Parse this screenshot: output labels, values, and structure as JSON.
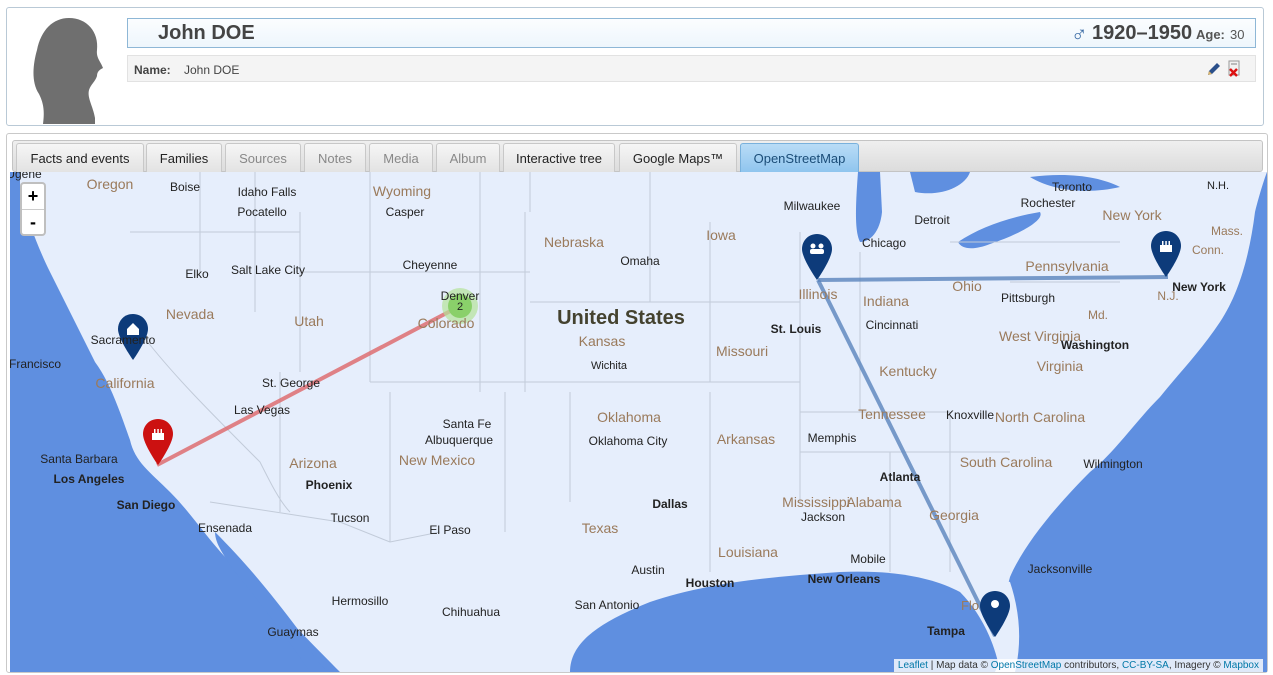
{
  "person": {
    "name": "John DOE",
    "gender_symbol": "♂",
    "lifespan": "1920–1950",
    "age_label": "Age:",
    "age_value": "30",
    "fact_name_label": "Name:",
    "fact_name_value": "John DOE"
  },
  "tabs": [
    {
      "label": "Facts and events",
      "state": "normal"
    },
    {
      "label": "Families",
      "state": "normal"
    },
    {
      "label": "Sources",
      "state": "dim"
    },
    {
      "label": "Notes",
      "state": "dim"
    },
    {
      "label": "Media",
      "state": "dim"
    },
    {
      "label": "Album",
      "state": "dim"
    },
    {
      "label": "Interactive tree",
      "state": "normal"
    },
    {
      "label": "Google Maps™",
      "state": "normal"
    },
    {
      "label": "OpenStreetMap",
      "state": "active"
    }
  ],
  "map": {
    "zoom_in": "+",
    "zoom_out": "-",
    "country_label": "United States",
    "states": [
      "Oregon",
      "Wyoming",
      "Nebraska",
      "Iowa",
      "Nevada",
      "Utah",
      "Colorado",
      "Kansas",
      "Missouri",
      "Illinois",
      "Indiana",
      "Ohio",
      "Pennsylvania",
      "New York",
      "California",
      "Kentucky",
      "West Virginia",
      "Virginia",
      "Tennessee",
      "North Carolina",
      "Oklahoma",
      "Arkansas",
      "Arizona",
      "New Mexico",
      "South Carolina",
      "Mississippi",
      "Alabama",
      "Georgia",
      "Texas",
      "Louisiana",
      "N.J.",
      "Mass.",
      "Conn.",
      "Md.",
      "Flo"
    ],
    "cities": [
      "Boise",
      "Idaho Falls",
      "Pocatello",
      "Casper",
      "Cheyenne",
      "Omaha",
      "Milwaukee",
      "Chicago",
      "Detroit",
      "Toronto",
      "Rochester",
      "Elko",
      "Salt Lake City",
      "Denver",
      "Sacramento",
      "Francisco",
      "St. George",
      "Las Vegas",
      "Santa Barbara",
      "Los Angeles",
      "San Diego",
      "Ensenada",
      "Phoenix",
      "Tucson",
      "Santa Fe",
      "Albuquerque",
      "El Paso",
      "Hermosillo",
      "Chihuahua",
      "Guaymas",
      "Wichita",
      "St. Louis",
      "Cincinnati",
      "Pittsburgh",
      "Washington",
      "New York",
      "Knoxville",
      "Memphis",
      "Atlanta",
      "Wilmington",
      "Oklahoma City",
      "Dallas",
      "Jackson",
      "Mobile",
      "New Orleans",
      "Austin",
      "Houston",
      "San Antonio",
      "Jacksonville",
      "Tampa",
      "Ugene",
      "N.H."
    ],
    "cluster_count": "2",
    "markers": [
      {
        "kind": "home",
        "place": "California",
        "color": "#0d3b7a"
      },
      {
        "kind": "birth",
        "place": "Los Angeles",
        "color": "#cc1111"
      },
      {
        "kind": "family",
        "place": "Illinois",
        "color": "#0d3b7a"
      },
      {
        "kind": "birth",
        "place": "New York",
        "color": "#0d3b7a"
      },
      {
        "kind": "pin",
        "place": "Florida",
        "color": "#0d3b7a"
      }
    ],
    "attribution": {
      "leaflet": "Leaflet",
      "sep": " | Map data © ",
      "osm": "OpenStreetMap",
      "mid": " contributors, ",
      "license": "CC-BY-SA",
      "imagery": ", Imagery © ",
      "mapbox": "Mapbox"
    }
  }
}
